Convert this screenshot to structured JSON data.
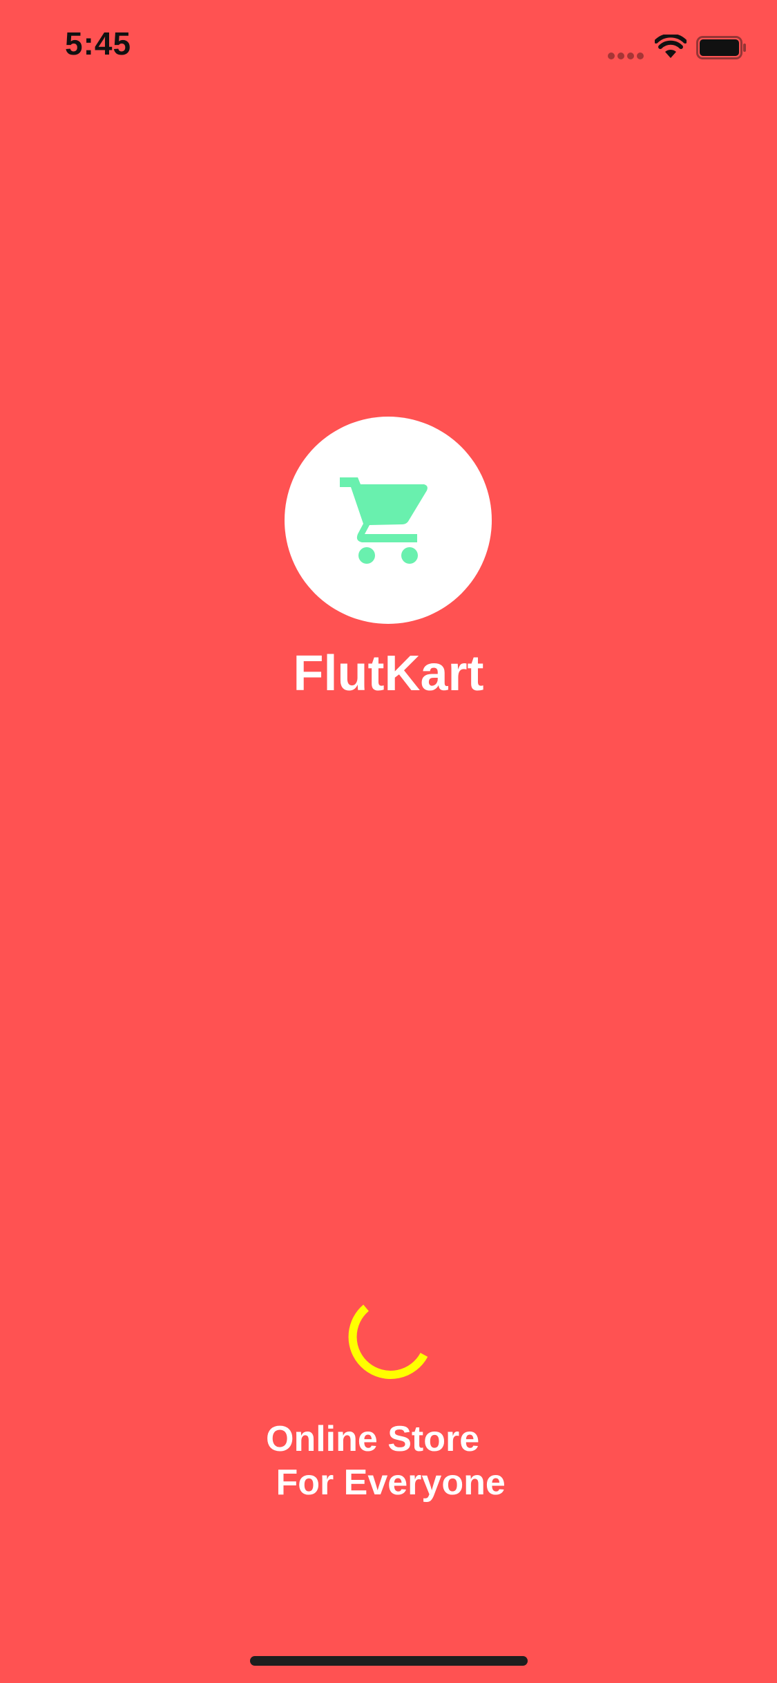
{
  "status_bar": {
    "time": "5:45",
    "icons": [
      "signal-dots-icon",
      "wifi-icon",
      "battery-icon"
    ]
  },
  "splash": {
    "logo_icon": "shopping-cart-icon",
    "app_name": "FlutKart",
    "loading_indicator": "progress-spinner",
    "tagline_line1": "Online Store",
    "tagline_line2": " For Everyone"
  },
  "colors": {
    "background": "#FF5252",
    "logo_circle": "#FFFFFF",
    "cart_icon": "#69F0AE",
    "spinner": "#FFFF00",
    "text": "#FFFFFF"
  }
}
